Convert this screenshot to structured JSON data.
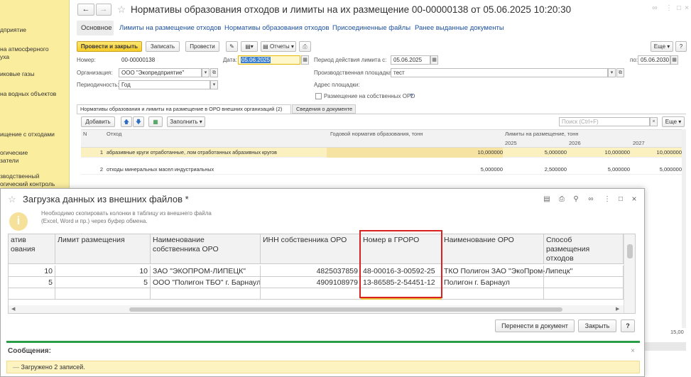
{
  "sidebar": {
    "items": [
      "дприятие",
      "на атмосферного\nуха",
      "иковые газы",
      "на водных объектов",
      "ищение с отходами",
      "огические\nзатели",
      "зводственный\nогический контроль"
    ]
  },
  "header": {
    "title": "Нормативы образования отходов и лимиты на их размещение 00-00000138 от 05.06.2025 10:20:30"
  },
  "tabs": [
    "Основное",
    "Лимиты на размещение отходов",
    "Нормативы образования отходов",
    "Присоединенные файлы",
    "Ранее выданные документы"
  ],
  "toolbar": {
    "post_close": "Провести и закрыть",
    "save": "Записать",
    "post": "Провести",
    "reports": "Отчеты",
    "more": "Еще"
  },
  "form": {
    "number_label": "Номер:",
    "number": "00-00000138",
    "date_label": "Дата:",
    "date": "05.06.2025",
    "period_label": "Период действия лимита с:",
    "period_from": "05.06.2025",
    "period_to_label": "по:",
    "period_to": "05.06.2030",
    "org_label": "Организация:",
    "org": "ООО \"Экопредприятие\"",
    "site_label": "Производственная площадка:",
    "site": "тест",
    "periodicity_label": "Периодичность:",
    "periodicity": "Год",
    "address_label": "Адрес площадки:",
    "own_oro_label": "Размещение на собственных ОРО",
    "help": "?"
  },
  "inner_tabs": [
    "Нормативы образования и лимиты на размещение в ОРО внешних организаций (2)",
    "Сведения о документе"
  ],
  "grid_toolbar": {
    "add": "Добавить",
    "fill": "Заполнить",
    "search_placeholder": "Поиск (Ctrl+F)",
    "more": "Еще"
  },
  "grid": {
    "headers": {
      "n": "N",
      "waste": "Отход",
      "norm": "Годовой норматив образования, тонн",
      "limits": "Лимиты на размещение, тонн"
    },
    "years": [
      "2025",
      "2026",
      "2027"
    ],
    "rows": [
      {
        "n": "1",
        "waste": "абразивные круги отработанные, лом отработанных абразивных кругов",
        "norm": "10,000000",
        "y2025": "5,000000",
        "y2026": "10,000000",
        "y2027": "10,000000"
      },
      {
        "n": "2",
        "waste": "отходы минеральных масел индустриальных",
        "norm": "5,000000",
        "y2025": "2,500000",
        "y2026": "5,000000",
        "y2027": "5,000000"
      }
    ],
    "footer_total": "15,00"
  },
  "dialog": {
    "title": "Загрузка данных из внешних файлов *",
    "info": "Необходимо скопировать колонки в таблицу из внешнего файла\n(Excel, Word и пр.) через буфер обмена.",
    "columns": [
      "атив\nования",
      "Лимит размещения",
      "Наименование\nсобственника ОРО",
      "ИНН собственника ОРО",
      "Номер в ГРОРО",
      "Наименование ОРО",
      "Способ\nразмещения\nотходов"
    ],
    "rows": [
      [
        "10",
        "10",
        "ЗАО \"ЭКОПРОМ-ЛИПЕЦК\"",
        "4825037859",
        "48-00016-3-00592-25",
        "ТКО Полигон ЗАО \"ЭкоПром-Липецк\"",
        ""
      ],
      [
        "5",
        "5",
        "ООО \"Полигон ТБО\" г. Барнаул",
        "4909108979",
        "13-86585-2-54451-12",
        "Полигон г. Барнаул",
        ""
      ]
    ],
    "transfer": "Перенести в документ",
    "close": "Закрыть",
    "help": "?"
  },
  "messages": {
    "title": "Сообщения:",
    "text": "Загружено 2 записей."
  },
  "colors": {
    "sidebar": "#fbed9e",
    "accent": "#f5cc2a",
    "highlight": "#d9221f",
    "message_bar": "#fdf3c0"
  }
}
